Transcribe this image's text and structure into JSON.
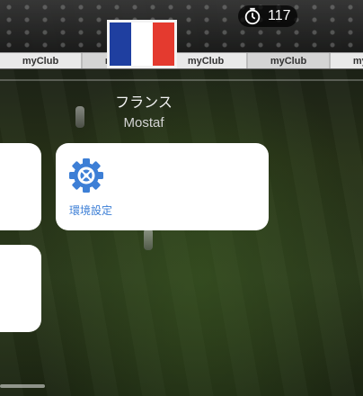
{
  "header": {
    "timer_value": "117"
  },
  "ad_board": {
    "texts": [
      "myClub",
      "myClub",
      "myClub",
      "myClub",
      "myClub"
    ]
  },
  "profile": {
    "country": "フランス",
    "player_name": "Mostaf",
    "flag_colors": [
      "#1f3fa0",
      "#ffffff",
      "#e43a2f"
    ]
  },
  "menu": {
    "settings_label": "環境設定"
  },
  "colors": {
    "accent": "#3d7fd6",
    "card": "#ffffff"
  },
  "icons": {
    "timer": "stopwatch-icon",
    "settings": "gear-icon"
  }
}
